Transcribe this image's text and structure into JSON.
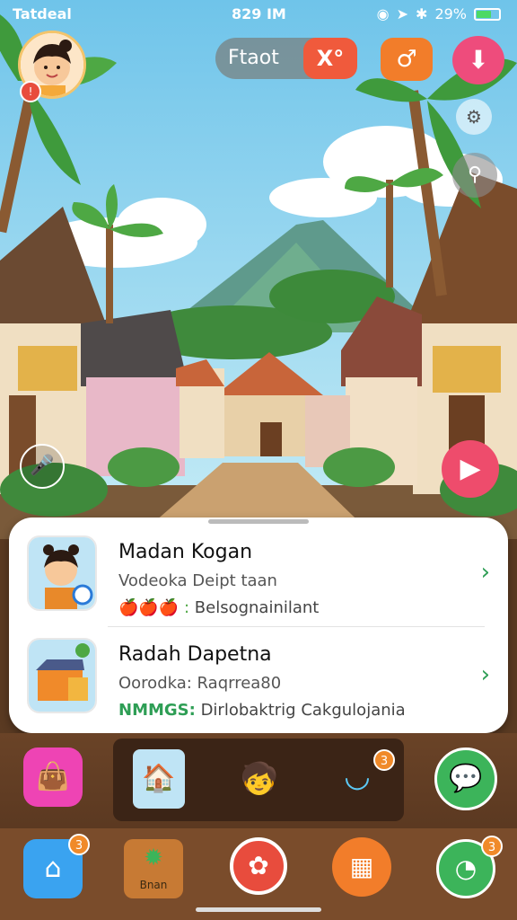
{
  "status": {
    "carrier": "Tatdeal",
    "time": "829 IM",
    "battery": "29%"
  },
  "header": {
    "pill_label": "Ftaot",
    "pill_close": "X°"
  },
  "list": [
    {
      "title": "Madan Kogan",
      "subtitle": "Vodeoka Deipt taan",
      "extra": "Belsognainilant",
      "extra_icons": "🍎🍎🍎 :"
    },
    {
      "title": "Radah Dapetna",
      "subtitle": "Oorodka: Raqrrea80",
      "extra": "NMMGS:",
      "extra2": "Dirlobaktrig Cakgulojania"
    }
  ],
  "nav": {
    "store_label": "Bnan",
    "home_badge": "3",
    "chat_badge": "3"
  },
  "tray": {
    "tray_badge": "3"
  },
  "colors": {
    "accent_green": "#2e9e55",
    "accent_pink": "#ee4c7c",
    "accent_orange": "#f08a2a"
  }
}
